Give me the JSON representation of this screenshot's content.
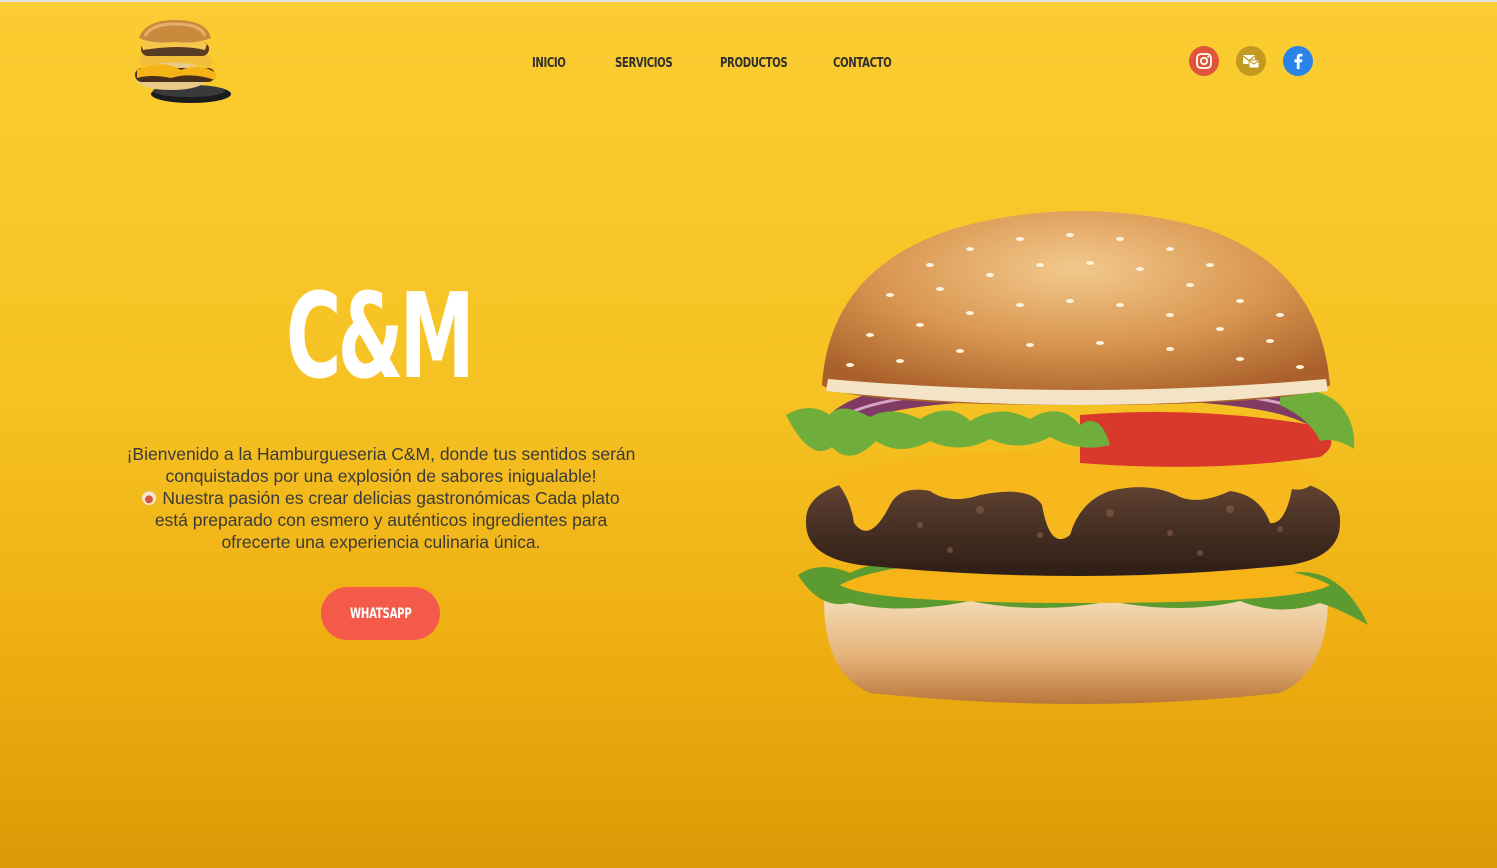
{
  "header": {
    "logo_alt": "Hamburguesa C&M logo",
    "nav": [
      "INICIO",
      "SERVICIOS",
      "PRODUCTOS",
      "CONTACTO"
    ],
    "social": [
      {
        "name": "instagram-icon",
        "color": "#e0553a"
      },
      {
        "name": "gmail-icon",
        "color": "#c29a1f"
      },
      {
        "name": "facebook-icon",
        "color": "#2a84e8"
      }
    ]
  },
  "hero": {
    "brand": "C&M",
    "intro_line1": "¡Bienvenido a la Hamburgueseria C&M, donde tus sentidos serán conquistados por una explosión de sabores inigualable!",
    "intro_line2": "Nuestra pasión es crear delicias gastronómicas Cada plato está preparado con esmero y auténticos ingredientes para ofrecerte una experiencia culinaria única.",
    "cta_label": "WHATSAPP",
    "cta_color": "#f45a4a"
  },
  "colors": {
    "background_top": "#fbcd32",
    "background_bottom": "#d99a06",
    "nav_text": "#2f2f2f",
    "brand_text": "#ffffff"
  }
}
